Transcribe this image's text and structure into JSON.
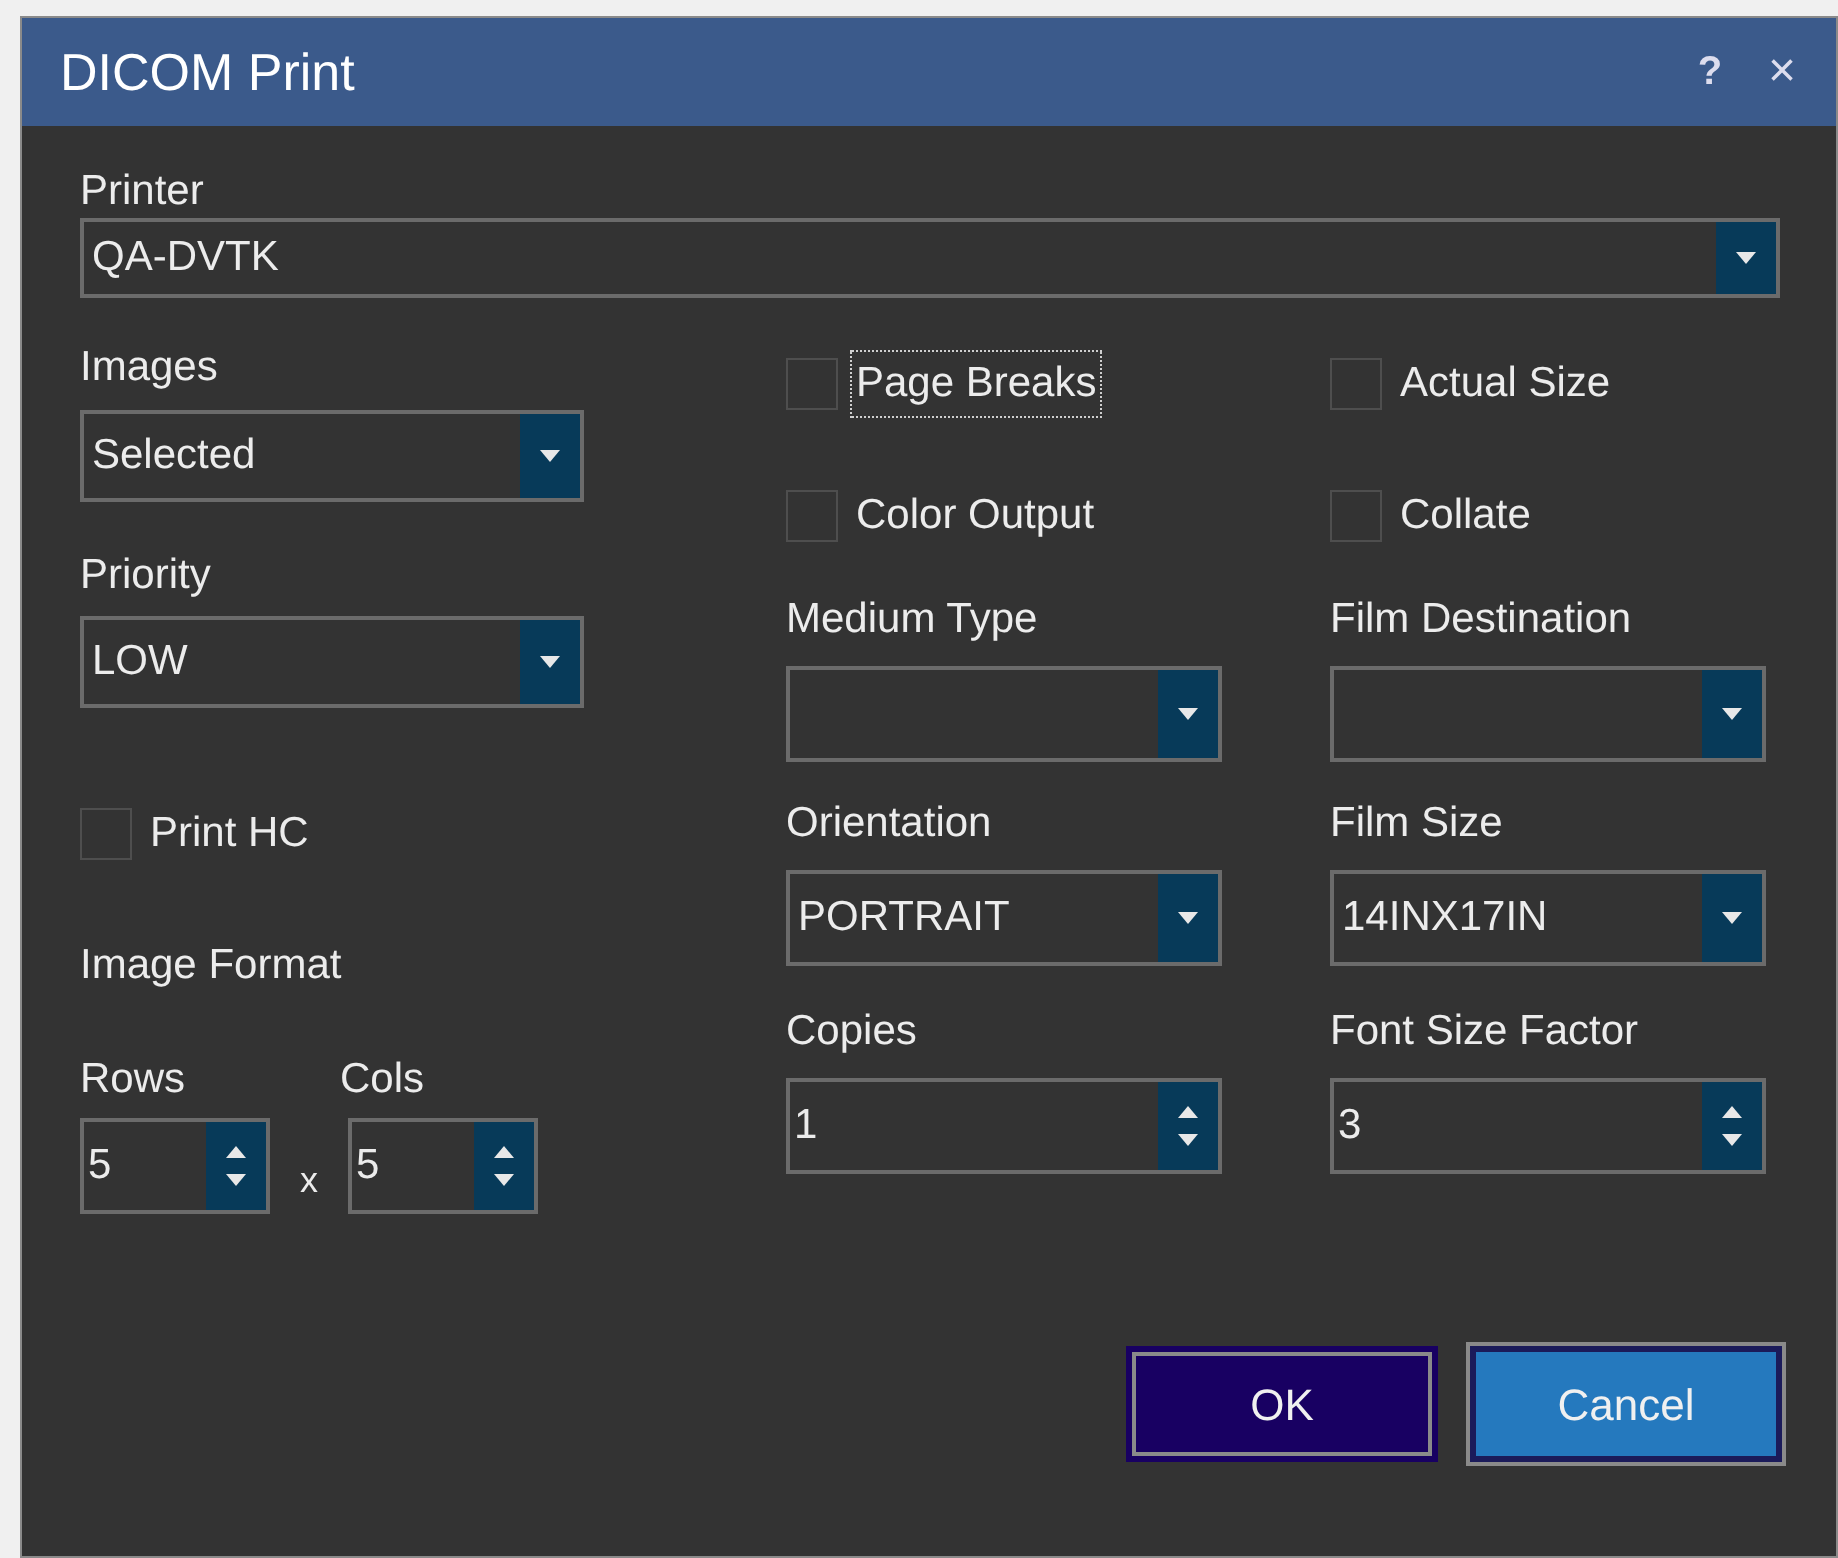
{
  "window": {
    "title": "DICOM Print",
    "help": "?",
    "close": "×"
  },
  "printer": {
    "label": "Printer",
    "value": "QA-DVTK"
  },
  "images": {
    "label": "Images",
    "value": "Selected"
  },
  "priority": {
    "label": "Priority",
    "value": "LOW"
  },
  "print_hc": {
    "label": "Print HC",
    "checked": false
  },
  "image_format": {
    "label": "Image Format",
    "rows": {
      "label": "Rows",
      "value": "5"
    },
    "separator": "x",
    "cols": {
      "label": "Cols",
      "value": "5"
    }
  },
  "options": [
    {
      "label": "Page Breaks",
      "checked": false,
      "focused": true
    },
    {
      "label": "Actual Size",
      "checked": false,
      "focused": false
    },
    {
      "label": "Color Output",
      "checked": false,
      "focused": false
    },
    {
      "label": "Collate",
      "checked": false,
      "focused": false
    }
  ],
  "fields": [
    {
      "kind": "combo",
      "label": "Medium Type"
    },
    {
      "kind": "combo",
      "label": "Film Destination"
    },
    {
      "kind": "combo",
      "label": "Orientation",
      "value": "PORTRAIT"
    },
    {
      "kind": "combo",
      "label": "Film Size",
      "value": "14INX17IN"
    },
    {
      "kind": "spinner",
      "label": "Copies",
      "value": "1"
    },
    {
      "kind": "spinner",
      "label": "Font Size Factor",
      "value": "3"
    }
  ],
  "buttons": [
    {
      "label": "OK",
      "kind": "default"
    },
    {
      "label": "Cancel",
      "kind": "hovered"
    }
  ]
}
